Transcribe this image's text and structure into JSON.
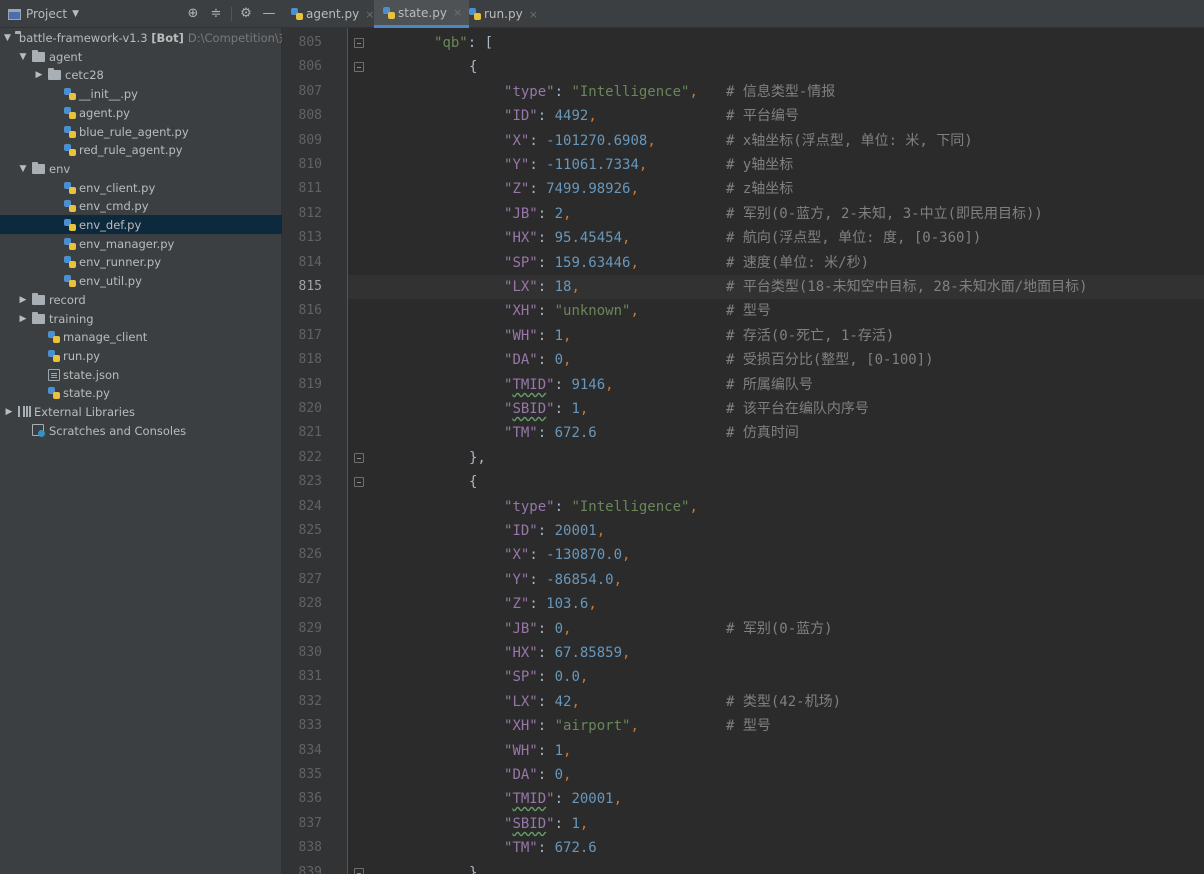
{
  "header": {
    "project_label": "Project",
    "icons": [
      "locate-icon",
      "collapse-icon",
      "gear-icon",
      "minimize-icon"
    ]
  },
  "tabs": [
    {
      "label": "agent.py",
      "active": false
    },
    {
      "label": "state.py",
      "active": true
    },
    {
      "label": "run.py",
      "active": false
    }
  ],
  "tree": {
    "root": {
      "name": "battle-framework-v1.3",
      "bold": "[Bot]",
      "path": "D:\\Competition\\对"
    },
    "items": [
      {
        "label": "agent",
        "kind": "folder"
      },
      {
        "label": "cetc28",
        "kind": "folder"
      },
      {
        "label": "__init__.py",
        "kind": "py"
      },
      {
        "label": "agent.py",
        "kind": "py"
      },
      {
        "label": "blue_rule_agent.py",
        "kind": "py"
      },
      {
        "label": "red_rule_agent.py",
        "kind": "py"
      },
      {
        "label": "env",
        "kind": "folder"
      },
      {
        "label": "env_client.py",
        "kind": "py"
      },
      {
        "label": "env_cmd.py",
        "kind": "py"
      },
      {
        "label": "env_def.py",
        "kind": "py"
      },
      {
        "label": "env_manager.py",
        "kind": "py"
      },
      {
        "label": "env_runner.py",
        "kind": "py"
      },
      {
        "label": "env_util.py",
        "kind": "py"
      },
      {
        "label": "record",
        "kind": "folder"
      },
      {
        "label": "training",
        "kind": "folder"
      },
      {
        "label": "manage_client",
        "kind": "py"
      },
      {
        "label": "run.py",
        "kind": "py"
      },
      {
        "label": "state.json",
        "kind": "json"
      },
      {
        "label": "state.py",
        "kind": "py"
      },
      {
        "label": "External Libraries",
        "kind": "lib"
      },
      {
        "label": "Scratches and Consoles",
        "kind": "scratch"
      }
    ]
  },
  "editor": {
    "current_line": "815",
    "lines": [
      {
        "n": "805",
        "key": "qb",
        "val": "[",
        "vtype": "punc",
        "comment": ""
      },
      {
        "n": "806",
        "raw": "{",
        "comment": ""
      },
      {
        "n": "807",
        "key": "type",
        "val": "\"Intelligence\"",
        "vtype": "str",
        "comment": "# 信息类型-情报"
      },
      {
        "n": "808",
        "key": "ID",
        "val": "4492",
        "vtype": "num",
        "comment": "# 平台编号"
      },
      {
        "n": "809",
        "key": "X",
        "val": "-101270.6908",
        "vtype": "num",
        "comment": "# x轴坐标(浮点型, 单位: 米, 下同)"
      },
      {
        "n": "810",
        "key": "Y",
        "val": "-11061.7334",
        "vtype": "num",
        "comment": "# y轴坐标"
      },
      {
        "n": "811",
        "key": "Z",
        "val": "7499.98926",
        "vtype": "num",
        "comment": "# z轴坐标"
      },
      {
        "n": "812",
        "key": "JB",
        "val": "2",
        "vtype": "num",
        "comment": "# 军别(0-蓝方, 2-未知, 3-中立(即民用目标))"
      },
      {
        "n": "813",
        "key": "HX",
        "val": "95.45454",
        "vtype": "num",
        "comment": "# 航向(浮点型, 单位: 度, [0-360])"
      },
      {
        "n": "814",
        "key": "SP",
        "val": "159.63446",
        "vtype": "num",
        "comment": "# 速度(单位: 米/秒)"
      },
      {
        "n": "815",
        "key": "LX",
        "val": "18",
        "vtype": "num",
        "comment": "# 平台类型(18-未知空中目标, 28-未知水面/地面目标)"
      },
      {
        "n": "816",
        "key": "XH",
        "val": "\"unknown\"",
        "vtype": "str",
        "comment": "# 型号"
      },
      {
        "n": "817",
        "key": "WH",
        "val": "1",
        "vtype": "num",
        "comment": "# 存活(0-死亡, 1-存活)"
      },
      {
        "n": "818",
        "key": "DA",
        "val": "0",
        "vtype": "num",
        "comment": "# 受损百分比(整型, [0-100])"
      },
      {
        "n": "819",
        "key": "TMID",
        "val": "9146",
        "vtype": "num",
        "comment": "# 所属编队号",
        "squig": true
      },
      {
        "n": "820",
        "key": "SBID",
        "val": "1",
        "vtype": "num",
        "comment": "# 该平台在编队内序号",
        "squig": true
      },
      {
        "n": "821",
        "key": "TM",
        "val": "672.6",
        "vtype": "num",
        "comment": "# 仿真时间",
        "nocomma": true
      },
      {
        "n": "822",
        "raw": "},",
        "comment": ""
      },
      {
        "n": "823",
        "raw": "{",
        "comment": ""
      },
      {
        "n": "824",
        "key": "type",
        "val": "\"Intelligence\"",
        "vtype": "str",
        "comment": ""
      },
      {
        "n": "825",
        "key": "ID",
        "val": "20001",
        "vtype": "num",
        "comment": ""
      },
      {
        "n": "826",
        "key": "X",
        "val": "-130870.0",
        "vtype": "num",
        "comment": ""
      },
      {
        "n": "827",
        "key": "Y",
        "val": "-86854.0",
        "vtype": "num",
        "comment": ""
      },
      {
        "n": "828",
        "key": "Z",
        "val": "103.6",
        "vtype": "num",
        "comment": ""
      },
      {
        "n": "829",
        "key": "JB",
        "val": "0",
        "vtype": "num",
        "comment": "# 军别(0-蓝方)"
      },
      {
        "n": "830",
        "key": "HX",
        "val": "67.85859",
        "vtype": "num",
        "comment": ""
      },
      {
        "n": "831",
        "key": "SP",
        "val": "0.0",
        "vtype": "num",
        "comment": ""
      },
      {
        "n": "832",
        "key": "LX",
        "val": "42",
        "vtype": "num",
        "comment": "# 类型(42-机场)"
      },
      {
        "n": "833",
        "key": "XH",
        "val": "\"airport\"",
        "vtype": "str",
        "comment": "# 型号"
      },
      {
        "n": "834",
        "key": "WH",
        "val": "1",
        "vtype": "num",
        "comment": ""
      },
      {
        "n": "835",
        "key": "DA",
        "val": "0",
        "vtype": "num",
        "comment": ""
      },
      {
        "n": "836",
        "key": "TMID",
        "val": "20001",
        "vtype": "num",
        "comment": "",
        "squig": true
      },
      {
        "n": "837",
        "key": "SBID",
        "val": "1",
        "vtype": "num",
        "comment": "",
        "squig": true
      },
      {
        "n": "838",
        "key": "TM",
        "val": "672.6",
        "vtype": "num",
        "comment": "",
        "nocomma": true
      },
      {
        "n": "839",
        "raw": "},",
        "comment": ""
      }
    ]
  },
  "colors": {
    "sidebar_bg": "#3c3f41",
    "editor_bg": "#2b2b2b",
    "selected_row": "#0d293e",
    "active_tab_underline": "#4a88c7",
    "string": "#6a8759",
    "number": "#6897bb",
    "keyword_punct": "#cc7832",
    "comment": "#808080"
  }
}
